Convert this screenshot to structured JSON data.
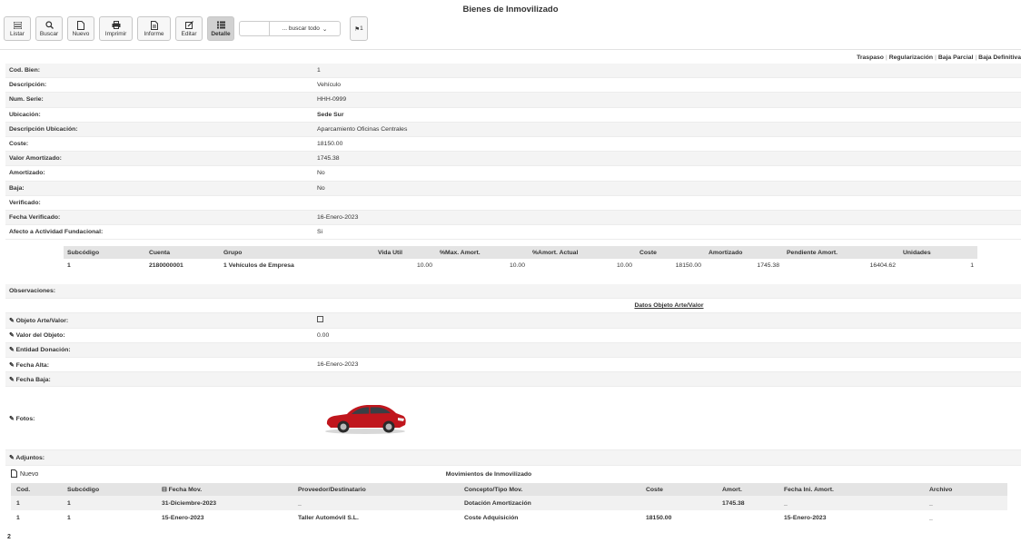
{
  "page": {
    "title": "Bienes de Inmovilizado"
  },
  "toolbar": {
    "listar": "Listar",
    "buscar": "Buscar",
    "nuevo": "Nuevo",
    "imprimir": "Imprimir",
    "informe": "Informe",
    "editar": "Editar",
    "detalle": "Detalle",
    "search_value": "",
    "search_select": "... buscar todo",
    "pin_count": "1"
  },
  "actions": {
    "traspaso": "Traspaso",
    "regularizacion": "Regularización",
    "baja_parcial": "Baja Parcial",
    "baja_definitiva": "Baja Definitiva"
  },
  "fields": [
    {
      "label": "Cod. Bien:",
      "value": "1"
    },
    {
      "label": "Descripción:",
      "value": "Vehículo"
    },
    {
      "label": "Num. Serie:",
      "value": "HHH-0999"
    },
    {
      "label": "Ubicación:",
      "value": "Sede Sur"
    },
    {
      "label": "Descripción Ubicación:",
      "value": "Aparcamiento Oficinas Centrales"
    },
    {
      "label": "Coste:",
      "value": "18150.00"
    },
    {
      "label": "Valor Amortizado:",
      "value": "1745.38"
    },
    {
      "label": "Amortizado:",
      "value": "No"
    },
    {
      "label": "Baja:",
      "value": "No"
    },
    {
      "label": "Verificado:",
      "value": ""
    },
    {
      "label": "Fecha Verificado:",
      "value": "16-Enero-2023"
    },
    {
      "label": "Afecto a Actividad Fundacional:",
      "value": "Si"
    }
  ],
  "subcodes": {
    "headers": [
      "Subcódigo",
      "Cuenta",
      "Grupo",
      "Vida Util",
      "%Max. Amort.",
      "%Amort. Actual",
      "Coste",
      "Amortizado",
      "Pendiente Amort.",
      "Unidades"
    ],
    "rows": [
      [
        "1",
        "2180000001",
        "1 Vehículos de Empresa",
        "10.00",
        "10.00",
        "10.00",
        "18150.00",
        "1745.38",
        "16404.62",
        "1"
      ]
    ]
  },
  "obs": {
    "observaciones_label": "Observaciones:",
    "datos_title": "Datos Objeto Arte/Valor",
    "objeto_arte_label": "Objeto Arte/Valor:",
    "valor_objeto_label": "Valor del Objeto:",
    "valor_objeto": "0.00",
    "entidad_label": "Entidad Donación:",
    "fecha_alta_label": "Fecha Alta:",
    "fecha_alta": "16-Enero-2023",
    "fecha_baja_label": "Fecha Baja:",
    "fotos_label": "Fotos:",
    "adjuntos_label": "Adjuntos:"
  },
  "movimientos": {
    "nuevo": "Nuevo",
    "title": "Movimientos de Inmovilizado",
    "headers": [
      "Cod.",
      "Subcódigo",
      "Fecha Mov.",
      "Proveedor/Destinatario",
      "Concepto/Tipo Mov.",
      "Coste",
      "Amort.",
      "Fecha Ini. Amort.",
      "Archivo"
    ],
    "rows": [
      [
        "1",
        "1",
        "31-Diciembre-2023",
        "_",
        "Dotación Amortización",
        "",
        "1745.38",
        "_",
        "_"
      ],
      [
        "1",
        "1",
        "15-Enero-2023",
        "Taller Automóvil S.L.",
        "Coste Adquisición",
        "18150.00",
        "",
        "15-Enero-2023",
        "_"
      ]
    ],
    "count": "2"
  },
  "colors": {
    "header_bg": "#e4e4e4",
    "alt_row": "#f4f4f4",
    "car_body": "#c0161d"
  }
}
